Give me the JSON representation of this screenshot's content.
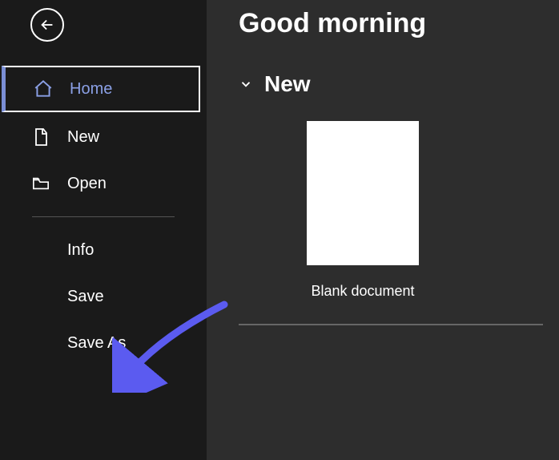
{
  "sidebar": {
    "items": [
      {
        "label": "Home",
        "icon": "home-icon",
        "selected": true
      },
      {
        "label": "New",
        "icon": "document-icon",
        "selected": false
      },
      {
        "label": "Open",
        "icon": "folder-open-icon",
        "selected": false
      }
    ],
    "secondary_items": [
      {
        "label": "Info"
      },
      {
        "label": "Save"
      },
      {
        "label": "Save As"
      }
    ]
  },
  "main": {
    "greeting": "Good morning",
    "section_new": "New",
    "template_blank": "Blank document"
  },
  "colors": {
    "accent": "#5b5bf0",
    "sidebar_bg": "#1a1a1a",
    "main_bg": "#2d2d2d"
  }
}
